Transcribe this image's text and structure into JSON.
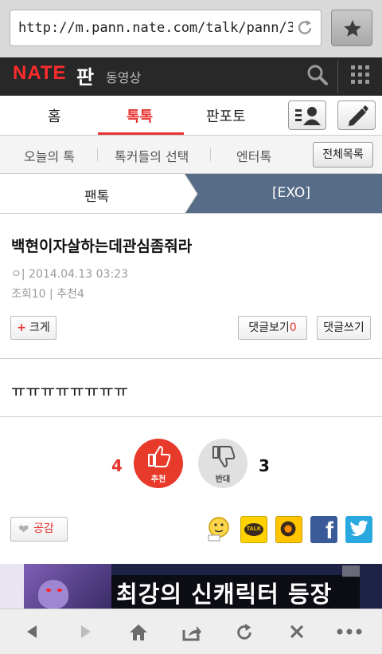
{
  "browser": {
    "url": "http://m.pann.nate.com/talk/pann/3",
    "icons": [
      "reload-icon",
      "star-icon"
    ]
  },
  "header": {
    "logo": "NATE",
    "service": "판",
    "video_link": "동영상",
    "icons": [
      "search-icon",
      "grid-menu-icon"
    ]
  },
  "main_tabs": [
    {
      "label": "홈",
      "active": false
    },
    {
      "label": "톡톡",
      "active": true
    },
    {
      "label": "판포토",
      "active": false
    }
  ],
  "sub_tabs": [
    "오늘의 톡",
    "톡커들의 선택",
    "엔터톡"
  ],
  "all_list_label": "전체목록",
  "breadcrumb": {
    "first": "팬톡",
    "second": "[EXO]"
  },
  "post": {
    "title": "백현이자살하는데관심좀줘라",
    "writer_and_date": "ㅇ|  2014.04.13 03:23",
    "stats": "조회10 | 추천4",
    "bigger_plus": "+",
    "bigger_label": "크게",
    "view_comments_label": "댓글보기",
    "comment_count": "0",
    "write_comment_label": "댓글쓰기",
    "body": "ㅠㅠㅠㅠㅠㅠㅠㅠ"
  },
  "votes": {
    "up_count": "4",
    "up_label": "추천",
    "down_label": "반대",
    "down_count": "3"
  },
  "share": {
    "empathy_label": "공감",
    "empathy_icon": "heart-icon",
    "kakaotalk_text": "TALK",
    "facebook_text": "f",
    "icons": [
      "emoticon-icon",
      "kakaotalk-icon",
      "kakaostory-icon",
      "facebook-icon",
      "twitter-icon"
    ]
  },
  "ad": {
    "text": "최강의 신캐릭터 등장"
  },
  "bottom_toolbar": [
    "back-icon",
    "forward-icon",
    "home-icon",
    "share-icon",
    "reload-icon",
    "close-icon",
    "more-icon"
  ],
  "colors": {
    "accent": "#e8322e",
    "breadcrumb_bg": "#566c87",
    "header_bg": "#282828"
  }
}
